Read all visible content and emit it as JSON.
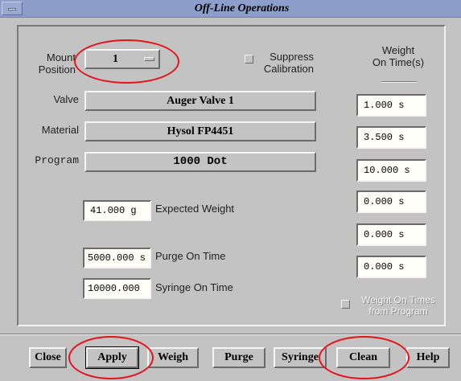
{
  "window": {
    "title": "Off-Line Operations"
  },
  "mount": {
    "label_line1": "Mount",
    "label_line2": "Position",
    "value": "1"
  },
  "suppress": {
    "label_line1": "Suppress",
    "label_line2": "Calibration"
  },
  "weight_header": {
    "line1": "Weight",
    "line2": "On Time(s)"
  },
  "valve": {
    "label": "Valve",
    "value": "Auger Valve 1"
  },
  "material": {
    "label": "Material",
    "value": "Hysol FP4451"
  },
  "program": {
    "label": "Program",
    "value": "1000 Dot"
  },
  "expected_weight": {
    "value": "41.000 g",
    "label": "Expected Weight"
  },
  "purge_on_time": {
    "value": "5000.000 s",
    "label": "Purge On Time"
  },
  "syringe_on_time": {
    "value": "10000.000",
    "label": "Syringe On Time"
  },
  "weight_on_times": [
    "1.000 s",
    "3.500 s",
    "10.000 s",
    "0.000 s",
    "0.000 s",
    "0.000 s"
  ],
  "program_times": {
    "line1": "Weight On Times",
    "line2": "from Program"
  },
  "buttons": {
    "close": "Close",
    "apply": "Apply",
    "weigh": "Weigh",
    "purge": "Purge",
    "syringe": "Syringe",
    "clean": "Clean",
    "help": "Help"
  },
  "colors": {
    "background": "#c3c3c3",
    "titlebar": "#8e9eca",
    "field": "#fffff7",
    "annotation": "#e8121a"
  }
}
